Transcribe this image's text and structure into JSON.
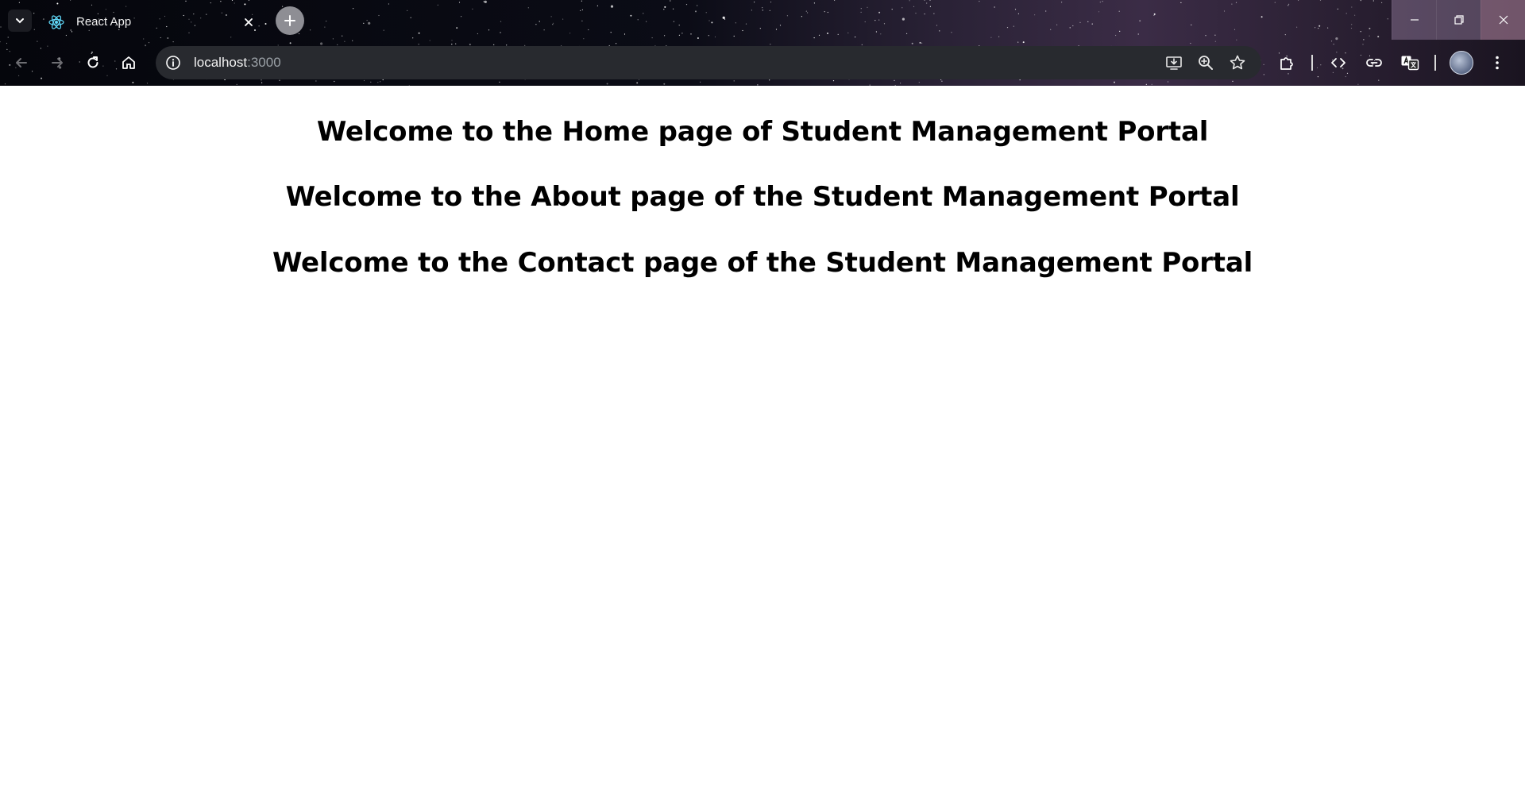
{
  "browser": {
    "tab": {
      "title": "React App"
    },
    "address_bar": {
      "host": "localhost",
      "port": ":3000"
    },
    "colors": {
      "chrome_bg": "#05060c",
      "omnibox_bg": "#282a2f",
      "page_bg": "#ffffff"
    }
  },
  "page": {
    "headings": {
      "home": "Welcome to the Home page of Student Management Portal",
      "about": "Welcome to the About page of the Student Management Portal",
      "contact": "Welcome to the Contact page of the Student Management Portal"
    }
  }
}
